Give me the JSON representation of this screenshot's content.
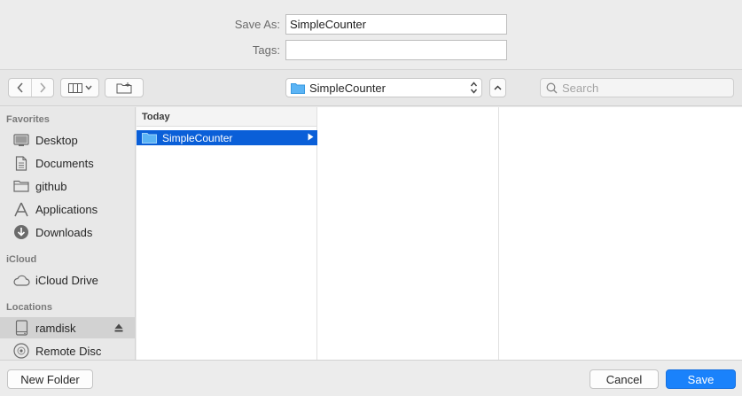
{
  "form": {
    "save_as_label": "Save As:",
    "save_as_value": "SimpleCounter",
    "tags_label": "Tags:",
    "tags_value": ""
  },
  "toolbar": {
    "back_icon": "chevron-left-icon",
    "forward_icon": "chevron-right-icon",
    "view_icon": "column-view-icon",
    "new_folder_icon": "folder-plus-icon",
    "location_value": "SimpleCounter",
    "collapse_icon": "chevron-up-icon",
    "search_placeholder": "Search"
  },
  "sidebar": {
    "sections": [
      {
        "label": "Favorites"
      },
      {
        "label": "iCloud"
      },
      {
        "label": "Locations"
      }
    ],
    "items": [
      {
        "label": "Desktop",
        "icon": "desktop-icon"
      },
      {
        "label": "Documents",
        "icon": "document-icon"
      },
      {
        "label": "github",
        "icon": "folder-icon"
      },
      {
        "label": "Applications",
        "icon": "applications-icon"
      },
      {
        "label": "Downloads",
        "icon": "download-icon"
      },
      {
        "label": "iCloud Drive",
        "icon": "cloud-icon"
      },
      {
        "label": "ramdisk",
        "icon": "disk-icon",
        "selected": true
      },
      {
        "label": "Remote Disc",
        "icon": "disc-icon"
      }
    ]
  },
  "browser": {
    "group_header": "Today",
    "selected_item": "SimpleCounter"
  },
  "footer": {
    "new_folder_label": "New Folder",
    "cancel_label": "Cancel",
    "save_label": "Save"
  },
  "colors": {
    "accent": "#1a82fb",
    "selection": "#0a5fd8",
    "folder": "#5bb4f5"
  }
}
